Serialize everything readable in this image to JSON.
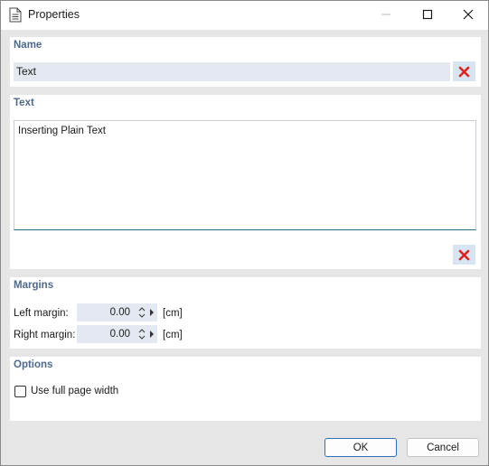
{
  "window": {
    "title": "Properties",
    "icons": {
      "title": "document-icon",
      "minimize": "minimize-icon",
      "maximize": "maximize-icon",
      "close": "close-icon"
    }
  },
  "name_section": {
    "heading": "Name",
    "value": "Text",
    "clear_icon": "red-x-icon"
  },
  "text_section": {
    "heading": "Text",
    "value": "Inserting Plain Text",
    "clear_icon": "red-x-icon"
  },
  "margins_section": {
    "heading": "Margins",
    "left": {
      "label": "Left margin:",
      "value": "0.00",
      "unit": "[cm]"
    },
    "right": {
      "label": "Right margin:",
      "value": "0.00",
      "unit": "[cm]"
    }
  },
  "options_section": {
    "heading": "Options",
    "full_page_width": {
      "label": "Use full page width",
      "checked": false
    }
  },
  "buttons": {
    "ok": "OK",
    "cancel": "Cancel"
  },
  "colors": {
    "heading": "#4d6a8c",
    "input_bg": "#e4e8f0",
    "clear_icon": "#e0201c",
    "ok_border": "#2e6fb8"
  }
}
